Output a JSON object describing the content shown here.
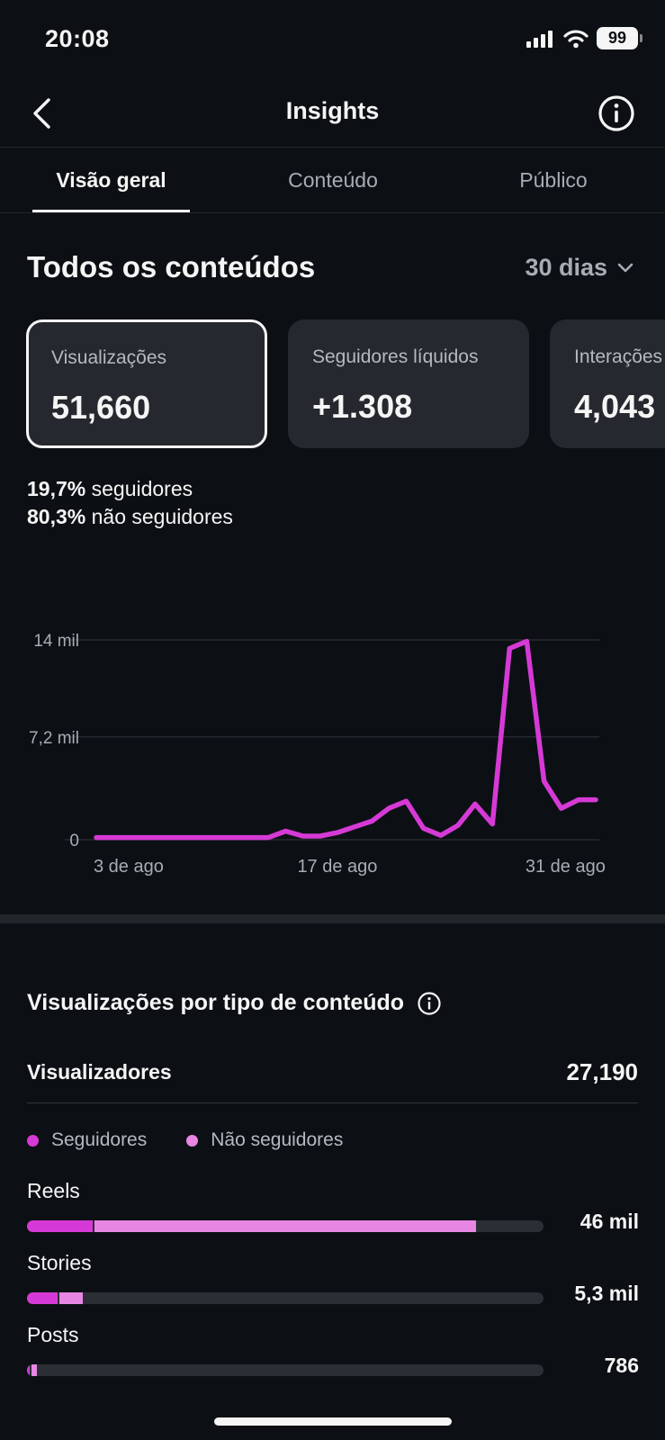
{
  "status": {
    "time": "20:08",
    "battery": "99"
  },
  "nav": {
    "title": "Insights"
  },
  "tabs": [
    {
      "label": "Visão geral"
    },
    {
      "label": "Conteúdo"
    },
    {
      "label": "Público"
    }
  ],
  "overview": {
    "heading": "Todos os conteúdos",
    "range": "30 dias",
    "cards": [
      {
        "label": "Visualizações",
        "value": "51,660"
      },
      {
        "label": "Seguidores líquidos",
        "value": "+1.308"
      },
      {
        "label": "Interações",
        "value": "4,043"
      }
    ],
    "followers_pct": "19,7%",
    "followers_text": "seguidores",
    "nonfollowers_pct": "80,3%",
    "nonfollowers_text": "não seguidores"
  },
  "chart_data": {
    "type": "line",
    "y_ticks": [
      "14 mil",
      "7,2 mil",
      "0"
    ],
    "x_ticks": [
      "3 de ago",
      "17 de ago",
      "31 de ago"
    ],
    "ylim": [
      0,
      14000
    ],
    "grid": true,
    "color": "#d63ad6",
    "x": [
      "3 ago",
      "4 ago",
      "5 ago",
      "6 ago",
      "7 ago",
      "8 ago",
      "9 ago",
      "10 ago",
      "11 ago",
      "12 ago",
      "13 ago",
      "14 ago",
      "15 ago",
      "16 ago",
      "17 ago",
      "18 ago",
      "19 ago",
      "20 ago",
      "21 ago",
      "22 ago",
      "23 ago",
      "24 ago",
      "25 ago",
      "26 ago",
      "27 ago",
      "28 ago",
      "29 ago",
      "30 ago",
      "31 ago",
      "1 set"
    ],
    "values": [
      150,
      150,
      150,
      150,
      150,
      150,
      150,
      150,
      150,
      150,
      150,
      600,
      250,
      250,
      500,
      900,
      1300,
      2200,
      2700,
      800,
      300,
      1000,
      2500,
      1100,
      13400,
      13900,
      4100,
      2200,
      2800,
      2800
    ]
  },
  "content_types": {
    "title": "Visualizações por tipo de conteúdo",
    "viewers_label": "Visualizadores",
    "viewers_value": "27,190",
    "legend": [
      {
        "label": "Seguidores",
        "color": "#d63ad6"
      },
      {
        "label": "Não seguidores",
        "color": "#e886e3"
      }
    ],
    "rows": [
      {
        "label": "Reels",
        "value": "46 mil",
        "followers_frac": 0.127,
        "nonfollowers_frac": 0.738
      },
      {
        "label": "Stories",
        "value": "5,3 mil",
        "followers_frac": 0.06,
        "nonfollowers_frac": 0.044
      },
      {
        "label": "Posts",
        "value": "786",
        "followers_frac": 0.005,
        "nonfollowers_frac": 0.01
      }
    ]
  },
  "colors": {
    "background": "#0c1014",
    "card": "#25282e",
    "accent_followers": "#d63ad6",
    "accent_nonfollowers": "#e886e3"
  }
}
